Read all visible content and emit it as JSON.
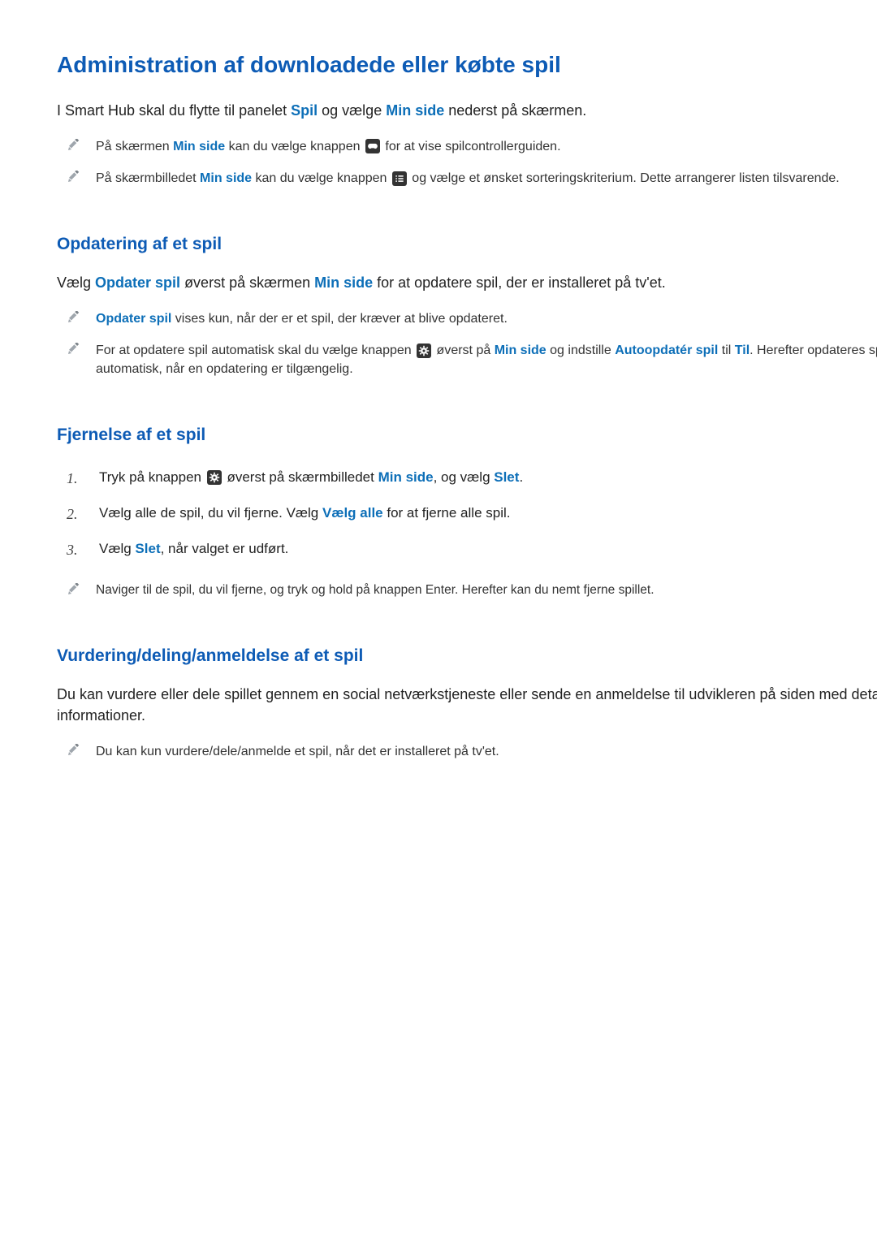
{
  "title": "Administration af downloadede eller købte spil",
  "intro": {
    "p1": "I Smart Hub skal du flytte til panelet ",
    "e1": "Spil",
    "p2": " og vælge ",
    "e2": "Min side",
    "p3": " nederst på skærmen."
  },
  "intro_notes": [
    {
      "p1": "På skærmen ",
      "e1": "Min side",
      "p2": " kan du vælge knappen ",
      "icon": "controller",
      "p3": " for at vise spilcontrollerguiden."
    },
    {
      "p1": "På skærmbilledet ",
      "e1": "Min side",
      "p2": " kan du vælge knappen ",
      "icon": "list",
      "p3": " og vælge et ønsket sorteringskriterium. Dette arrangerer listen tilsvarende."
    }
  ],
  "section_update": {
    "heading": "Opdatering af et spil",
    "intro": {
      "p1": "Vælg ",
      "e1": "Opdater spil",
      "p2": " øverst på skærmen ",
      "e2": "Min side",
      "p3": " for at opdatere spil, der er installeret på tv'et."
    },
    "notes": [
      {
        "e1": "Opdater spil",
        "p1": " vises kun, når der er et spil, der kræver at blive opdateret."
      },
      {
        "p1": "For at opdatere spil automatisk skal du vælge knappen ",
        "icon": "gear",
        "p2": " øverst på ",
        "e1": "Min side",
        "p3": " og indstille ",
        "e2": "Autoopdatér spil",
        "p4": " til ",
        "e3": "Til",
        "p5": ". Herefter opdateres spil automatisk, når en opdatering er tilgængelig."
      }
    ]
  },
  "section_remove": {
    "heading": "Fjernelse af et spil",
    "steps": [
      {
        "p1": "Tryk på knappen ",
        "icon": "gear",
        "p2": " øverst på skærmbilledet ",
        "e1": "Min side",
        "p3": ", og vælg ",
        "e2": "Slet",
        "p4": "."
      },
      {
        "p1": "Vælg alle de spil, du vil fjerne. Vælg ",
        "e1": "Vælg alle",
        "p2": " for at fjerne alle spil."
      },
      {
        "p1": "Vælg ",
        "e1": "Slet",
        "p2": ", når valget er udført."
      }
    ],
    "subnote": "Naviger til de spil, du vil fjerne, og tryk og hold på knappen Enter. Herefter kan du nemt fjerne spillet."
  },
  "section_rate": {
    "heading": "Vurdering/deling/anmeldelse af et spil",
    "intro": "Du kan vurdere eller dele spillet gennem en social netværkstjeneste eller sende en anmeldelse til udvikleren på siden med detaljerede informationer.",
    "note": "Du kan kun vurdere/dele/anmelde et spil, når det er installeret på tv'et."
  },
  "icons": {
    "controller": "controller-icon",
    "list": "list-icon",
    "gear": "gear-icon",
    "pencil": "pencil-icon"
  }
}
